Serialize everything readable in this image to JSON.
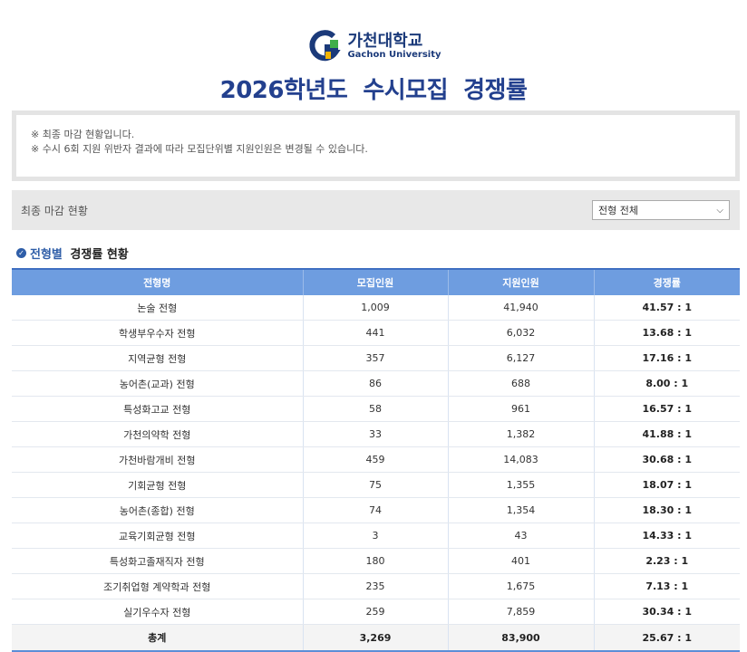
{
  "header": {
    "logo_ko": "가천대학교",
    "logo_en": "Gachon University",
    "title": "2026학년도  수시모집  경쟁률"
  },
  "notice": {
    "line1": "※ 최종 마감 현황입니다.",
    "line2": "※ 수시 6회 지원 위반자 결과에 따라 모집단위별 지원인원은 변경될 수 있습니다."
  },
  "filter": {
    "label": "최종 마감 현황",
    "select_value": "전형 전체"
  },
  "section": {
    "title_highlight": "전형별",
    "title_rest": " 경쟁률 현황"
  },
  "table": {
    "headers": [
      "전형명",
      "모집인원",
      "지원인원",
      "경쟁률"
    ],
    "rows": [
      [
        "논술 전형",
        "1,009",
        "41,940",
        "41.57 : 1"
      ],
      [
        "학생부우수자 전형",
        "441",
        "6,032",
        "13.68 : 1"
      ],
      [
        "지역균형 전형",
        "357",
        "6,127",
        "17.16 : 1"
      ],
      [
        "농어촌(교과) 전형",
        "86",
        "688",
        "8.00 : 1"
      ],
      [
        "특성화고교 전형",
        "58",
        "961",
        "16.57 : 1"
      ],
      [
        "가천의약학 전형",
        "33",
        "1,382",
        "41.88 : 1"
      ],
      [
        "가천바람개비 전형",
        "459",
        "14,083",
        "30.68 : 1"
      ],
      [
        "기회균형 전형",
        "75",
        "1,355",
        "18.07 : 1"
      ],
      [
        "농어촌(종합) 전형",
        "74",
        "1,354",
        "18.30 : 1"
      ],
      [
        "교육기회균형 전형",
        "3",
        "43",
        "14.33 : 1"
      ],
      [
        "특성화고졸재직자 전형",
        "180",
        "401",
        "2.23 : 1"
      ],
      [
        "조기취업형 계약학과 전형",
        "235",
        "1,675",
        "7.13 : 1"
      ],
      [
        "실기우수자 전형",
        "259",
        "7,859",
        "30.34 : 1"
      ]
    ],
    "total": [
      "총계",
      "3,269",
      "83,900",
      "25.67 : 1"
    ]
  },
  "colors": {
    "title_blue": "#23408e",
    "header_blue": "#6e9de0",
    "logo_green": "#3fae49"
  }
}
